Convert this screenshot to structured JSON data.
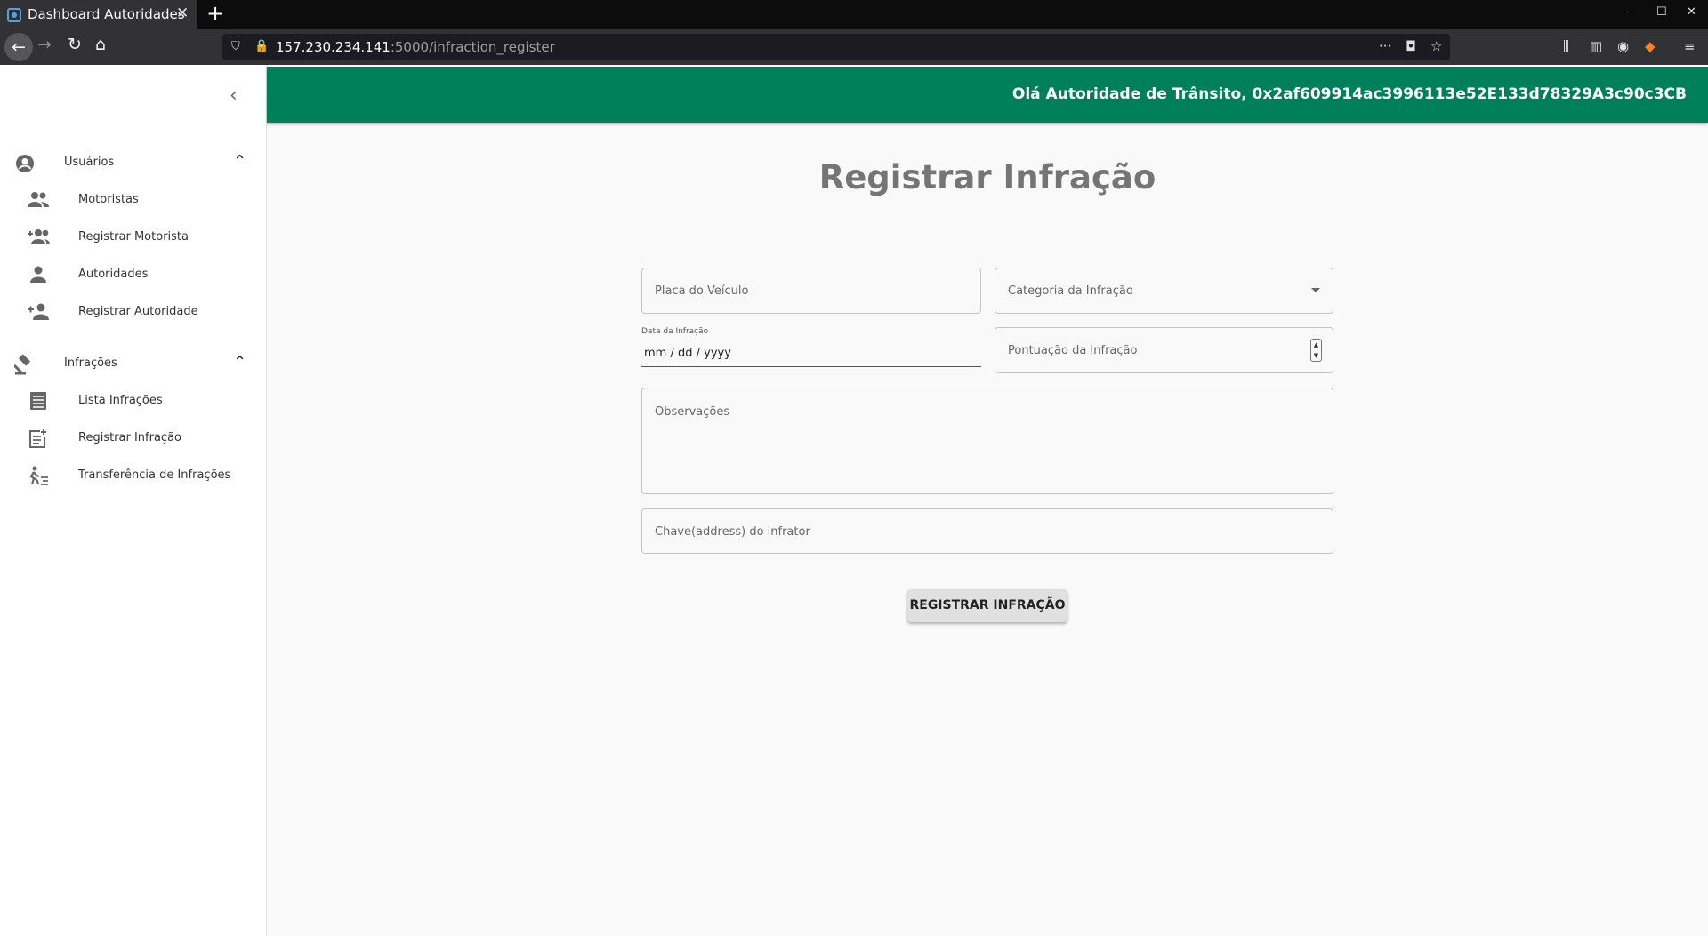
{
  "browser": {
    "tab_title": "Dashboard Autoridades",
    "tab_close": "✕",
    "new_tab": "+",
    "url_host": "157.230.234.141",
    "url_path": ":5000/infraction_register",
    "more_icon_glyph": "···"
  },
  "sidebar": {
    "sections": [
      {
        "label": "Usuários",
        "icon": "account-circle-icon",
        "items": [
          {
            "label": "Motoristas",
            "icon": "people-icon"
          },
          {
            "label": "Registrar Motorista",
            "icon": "group-add-icon"
          },
          {
            "label": "Autoridades",
            "icon": "person-icon"
          },
          {
            "label": "Registrar Autoridade",
            "icon": "person-add-icon"
          }
        ]
      },
      {
        "label": "Infrações",
        "icon": "gavel-icon",
        "items": [
          {
            "label": "Lista Infrações",
            "icon": "list-icon"
          },
          {
            "label": "Registrar Infração",
            "icon": "post-add-icon"
          },
          {
            "label": "Transferência de Infrações",
            "icon": "transfer-icon"
          }
        ]
      }
    ]
  },
  "header": {
    "greeting": "Olá Autoridade de Trânsito, 0x2af609914ac3996113e52E133d78329A3c90c3CB",
    "bar_color": "#00805a"
  },
  "form": {
    "title": "Registrar Infração",
    "placa_placeholder": "Placa do Veículo",
    "categoria_placeholder": "Categoria da Infração",
    "data_label": "Data da Infração",
    "data_value": "mm / dd / yyyy",
    "pontuacao_placeholder": "Pontuação da Infração",
    "observacoes_placeholder": "Observações",
    "chave_placeholder": "Chave(address) do infrator",
    "submit_label": "REGISTRAR INFRAÇÃO"
  }
}
